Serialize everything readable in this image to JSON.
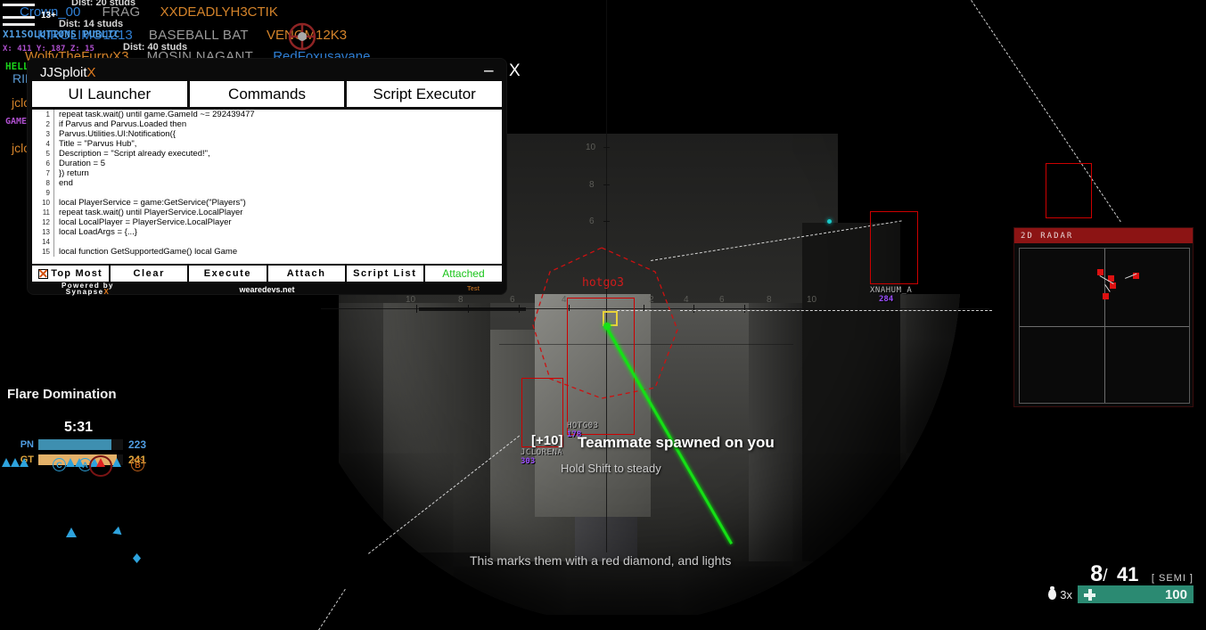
{
  "game": {
    "killfeed": [
      {
        "dist": "Dist: 20 studs",
        "killer": "",
        "weapon": "",
        "victim": ""
      },
      {
        "killer": "Crown_00",
        "weapon": "FRAG",
        "victim": "XXDEADLYH3CTIK",
        "dist": "Dist: 14 studs"
      },
      {
        "killer": "KIROLIMO1213",
        "weapon": "BASEBALL BAT",
        "victim": "VENOM12K3",
        "dist": "Dist: 40 studs"
      },
      {
        "killer": "WolfvTheFurryX3",
        "weapon": "MOSIN NAGANT",
        "victim": "RedFoxusavane",
        "dist": ""
      }
    ],
    "rank_badge": "13+",
    "clan_tag": "X11SOLUTIONS PUBLIC",
    "coords": "X: 411 Y: 187 Z: 15",
    "chat": [
      {
        "text": "HELLO",
        "color": "#1ad11a"
      },
      {
        "text": "RIK",
        "color": "#5b9bd5"
      },
      {
        "text": "jclo",
        "color": "#d4832a"
      },
      {
        "text": "GAME:",
        "color": "#b050d0"
      },
      {
        "text": "jclo",
        "color": "#d4832a"
      }
    ],
    "scoreboard": {
      "mode": "Flare Domination",
      "timer": "5:31",
      "teams": [
        {
          "tag": "PN",
          "score": "223",
          "color": "#3e8fb0",
          "pct": 86
        },
        {
          "tag": "GT",
          "score": "241",
          "color": "#e3b濃",
          "pct": 93
        }
      ],
      "capture_points": [
        "C",
        "A",
        "B"
      ]
    },
    "ammo": {
      "current": "8",
      "slash": "/",
      "reserve": "41",
      "mode": "[ SEMI ]"
    },
    "grenades": "3x",
    "health": "100",
    "radar": {
      "title": "2D RADAR"
    },
    "messages": {
      "spawn": "Teammate spawned on you",
      "score_pop": "[+10]",
      "hint": "Hold Shift to steady",
      "tip": "This marks them with a red diamond, and lights"
    },
    "esp": {
      "target_name": "hotgo3",
      "entities": [
        {
          "name": "HOTG03",
          "hp": "178"
        },
        {
          "name": "JCLORENA",
          "hp": "303"
        },
        {
          "name": "XNAHUM_A",
          "hp": "284"
        }
      ]
    },
    "scope_mils": [
      "10",
      "8",
      "6",
      "4",
      "2"
    ]
  },
  "jjsploit": {
    "title": "JJSploit",
    "title_x": "X",
    "minimize": "–",
    "close": "X",
    "tabs": [
      {
        "label": "UI Launcher"
      },
      {
        "label": "Commands"
      },
      {
        "label": "Script Executor"
      }
    ],
    "code": [
      {
        "n": "1",
        "t": "repeat task.wait() until game.GameId ~= 292439477"
      },
      {
        "n": "2",
        "t": "if Parvus and Parvus.Loaded then"
      },
      {
        "n": "3",
        "t": "Parvus.Utilities.UI:Notification({"
      },
      {
        "n": "4",
        "t": "Title = \"Parvus Hub\","
      },
      {
        "n": "5",
        "t": "Description = \"Script already executed!\","
      },
      {
        "n": "6",
        "t": "Duration = 5"
      },
      {
        "n": "7",
        "t": "}) return"
      },
      {
        "n": "8",
        "t": "end"
      },
      {
        "n": "9",
        "t": ""
      },
      {
        "n": "10",
        "t": "local PlayerService = game:GetService(\"Players\")"
      },
      {
        "n": "11",
        "t": "repeat task.wait() until PlayerService.LocalPlayer"
      },
      {
        "n": "12",
        "t": "local LocalPlayer = PlayerService.LocalPlayer"
      },
      {
        "n": "13",
        "t": "local LoadArgs = {...}"
      },
      {
        "n": "14",
        "t": ""
      },
      {
        "n": "15",
        "t": "local function GetSupportedGame() local Game"
      }
    ],
    "buttons": [
      {
        "label": "Top Most",
        "kind": "check"
      },
      {
        "label": "Clear",
        "kind": "normal"
      },
      {
        "label": "Execute",
        "kind": "normal"
      },
      {
        "label": "Attach",
        "kind": "normal"
      },
      {
        "label": "Script List",
        "kind": "normal"
      },
      {
        "label": "Attached",
        "kind": "status"
      }
    ],
    "footer": {
      "powered_1": "Powered by",
      "powered_2": "Synapse",
      "powered_x": "X",
      "site": "wearedevs.net",
      "test": "Test"
    }
  }
}
